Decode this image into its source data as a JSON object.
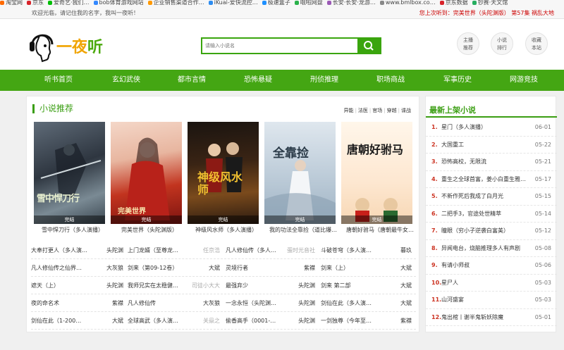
{
  "bookmarks": [
    {
      "label": "淘宝网",
      "color": "#ff6a00"
    },
    {
      "label": "京东",
      "color": "#d8232a"
    },
    {
      "label": "爱奇艺·我们…",
      "color": "#00be06"
    },
    {
      "label": "bob体育游戏网站",
      "color": "#3388ff"
    },
    {
      "label": "企业销售渠道合作…",
      "color": "#ff9900"
    },
    {
      "label": "iKuai-爱快流控…",
      "color": "#2d8cf0"
    },
    {
      "label": "极速盒子",
      "color": "#1e90ff"
    },
    {
      "label": "哦啦网盘",
      "color": "#2bb24c"
    },
    {
      "label": "长安·长安·龙游…",
      "color": "#9b59b6"
    },
    {
      "label": "www.bmlbox.co…",
      "color": "#888888"
    },
    {
      "label": "京东数据",
      "color": "#d8232a"
    },
    {
      "label": "钞赛·天文馆",
      "color": "#27ae60"
    }
  ],
  "topbar": {
    "welcome": "欢迎光临，请记住我的名字，我叫一夜听！",
    "last_prefix": "您上次听到：",
    "last_book": "完美世界（头陀渊版）",
    "last_episode": "第57集",
    "last_title": "祸乱大地"
  },
  "logo": {
    "char1": "一夜",
    "char2": "听"
  },
  "search": {
    "placeholder": "请输入小说名"
  },
  "circles": [
    {
      "line1": "主播",
      "line2": "推荐"
    },
    {
      "line1": "小说",
      "line2": "排行"
    },
    {
      "line1": "收藏",
      "line2": "本站"
    }
  ],
  "nav": [
    "听书首页",
    "玄幻武侠",
    "都市言情",
    "恐怖悬疑",
    "刑侦推理",
    "职场商战",
    "军事历史",
    "网游竞技"
  ],
  "recommend": {
    "title": "小说推荐",
    "categories": [
      "异能",
      "法医",
      "官场",
      "穿越",
      "谍战"
    ],
    "books": [
      {
        "name": "雪中悍刀行（多人演播）",
        "badge": "完结",
        "cover_text": "雪中悍刀行"
      },
      {
        "name": "完美世界（头陀渊版）",
        "badge": "完结",
        "cover_text": "完美世界"
      },
      {
        "name": "神级风水师（多人演播）",
        "badge": "完结",
        "cover_text": "神级风水师"
      },
      {
        "name": "我的功法全靠捡（道比爆…",
        "badge": "完结",
        "cover_text": "全靠捡"
      },
      {
        "name": "唐朝好驸马（唐朝最牛女…",
        "badge": "完结",
        "cover_text": "唐朝好驸马"
      }
    ],
    "rows": [
      [
        [
          "大奉打更人（多人演…",
          "头陀渊",
          false
        ],
        [
          "上门龙婿（至尊龙…",
          "任京浩",
          true
        ],
        [
          "凡人修仙传（多人…",
          "蛋时光音社",
          true
        ],
        [
          "斗破苍穹（多人演…",
          "暮玖",
          false
        ]
      ],
      [
        [
          "凡人修仙传之仙界…",
          "大灰狼",
          false
        ],
        [
          "剑来（第09-12卷）",
          "大斌",
          false
        ],
        [
          "灵境行者",
          "紫襟",
          false
        ],
        [
          "剑来（上）",
          "大斌",
          false
        ]
      ],
      [
        [
          "遮天（上）",
          "头陀渊",
          false
        ],
        [
          "我师兄实在太稳健…",
          "司徒小大大",
          true
        ],
        [
          "最强弃少",
          "头陀渊",
          false
        ],
        [
          "剑来 第二部",
          "大斌",
          false
        ]
      ],
      [
        [
          "夜的命名术",
          "紫襟",
          false
        ],
        [
          "凡人修仙传",
          "大灰狼",
          false
        ],
        [
          "一念永恒（头陀渊…",
          "头陀渊",
          false
        ],
        [
          "剑仙在此（多人演…",
          "大斌",
          false
        ]
      ],
      [
        [
          "剑仙在此（1-200…",
          "大斌",
          false
        ],
        [
          "全球高武（多人演…",
          "关赑之",
          true
        ],
        [
          "偷香高手（0001-…",
          "头陀渊",
          false
        ],
        [
          "一剑独尊（今年至…",
          "紫襟",
          false
        ]
      ]
    ]
  },
  "latest": {
    "title": "最新上架小说",
    "items": [
      {
        "n": "1.",
        "t": "星门（多人演播）",
        "d": "06-01"
      },
      {
        "n": "2.",
        "t": "大国重工",
        "d": "05-22"
      },
      {
        "n": "3.",
        "t": "恐怖高校，无限流",
        "d": "05-21"
      },
      {
        "n": "4.",
        "t": "重生之全球首富，姜小白重生雅…",
        "d": "05-17"
      },
      {
        "n": "5.",
        "t": "不新作死后我成了白月光",
        "d": "05-15"
      },
      {
        "n": "6.",
        "t": "二把手3，官途处世精萃",
        "d": "05-14"
      },
      {
        "n": "7.",
        "t": "瞳眼（穷小子逆袭白富美）",
        "d": "05-12"
      },
      {
        "n": "8.",
        "t": "异闻电台，烧脑推理多人有声剧",
        "d": "05-08"
      },
      {
        "n": "9.",
        "t": "有请小师叔",
        "d": "05-06"
      },
      {
        "n": "10.",
        "t": "星尸人",
        "d": "05-03"
      },
      {
        "n": "11.",
        "t": "山河盛宴",
        "d": "05-03"
      },
      {
        "n": "12.",
        "t": "鬼出棺丨谢半鬼斩妖除魔",
        "d": "05-01"
      }
    ]
  },
  "colors": {
    "accent": "#44a613",
    "alert": "#cc0000"
  }
}
